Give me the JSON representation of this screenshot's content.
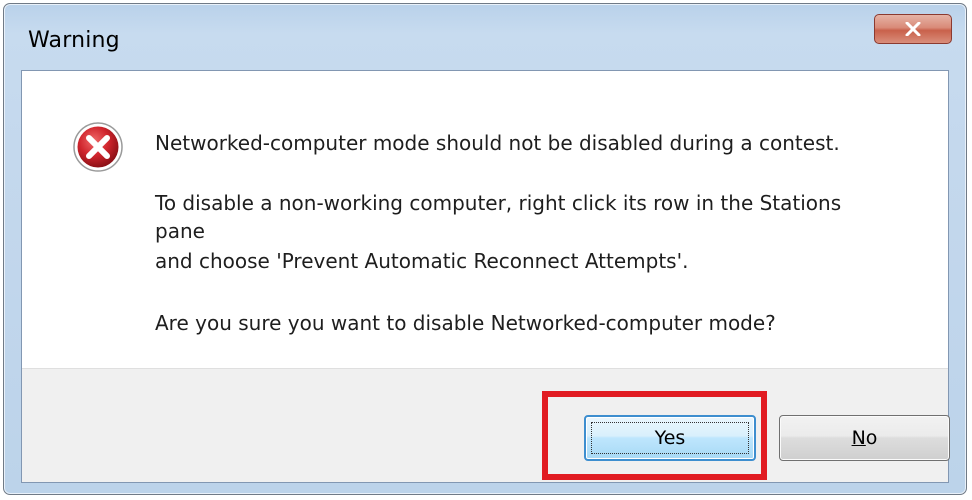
{
  "window": {
    "title": "Warning"
  },
  "icon": {
    "type": "error-icon",
    "color": "#c8232c"
  },
  "message": {
    "line1": "Networked-computer mode should not be disabled during a contest.",
    "line2": "To disable a non-working computer, right click its row in the Stations",
    "line3": "pane",
    "line4": "and choose 'Prevent Automatic Reconnect Attempts'.",
    "line5": "Are you sure you want to disable Networked-computer mode?"
  },
  "buttons": {
    "yes_label": "Yes",
    "no_label_rest": "o",
    "no_mnemonic": "N"
  },
  "colors": {
    "highlight": "#e11b22",
    "default_button_border": "#3d8ecf"
  }
}
